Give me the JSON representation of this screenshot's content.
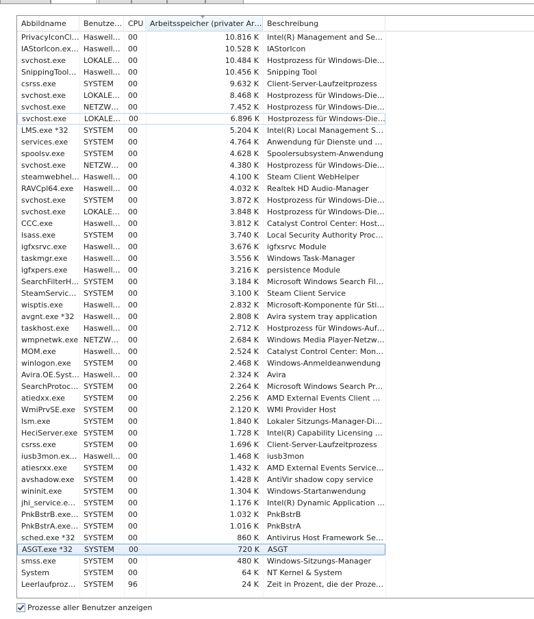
{
  "columns": [
    "Abbildname",
    "Benutze…",
    "CPU",
    "Arbeitsspeicher (privater Arbei…",
    "Beschreibung"
  ],
  "sorted_column": "Arbeitsspeicher (privater Arbei…",
  "selected_process": "ASGT.exe *32",
  "hovered_process": "svchost.exe",
  "processes": [
    {
      "name": "PrivacyIconCli…",
      "user": "Haswell…",
      "cpu": "00",
      "mem": "10.816 K",
      "desc": "Intel(R) Management and Secu…"
    },
    {
      "name": "IAStorIcon.ex…",
      "user": "Haswell…",
      "cpu": "00",
      "mem": "10.528 K",
      "desc": "IAStorIcon"
    },
    {
      "name": "svchost.exe",
      "user": "LOKALE…",
      "cpu": "00",
      "mem": "10.484 K",
      "desc": "Hostprozess für Windows-Dienste"
    },
    {
      "name": "SnippingTool…",
      "user": "Haswell…",
      "cpu": "00",
      "mem": "10.456 K",
      "desc": "Snipping Tool"
    },
    {
      "name": "csrss.exe",
      "user": "SYSTEM",
      "cpu": "00",
      "mem": "9.632 K",
      "desc": "Client-Server-Laufzeitprozess"
    },
    {
      "name": "svchost.exe",
      "user": "LOKALE…",
      "cpu": "00",
      "mem": "8.468 K",
      "desc": "Hostprozess für Windows-Dienste"
    },
    {
      "name": "svchost.exe",
      "user": "NETZW…",
      "cpu": "00",
      "mem": "7.452 K",
      "desc": "Hostprozess für Windows-Dienste"
    },
    {
      "name": "svchost.exe",
      "user": "LOKALE…",
      "cpu": "00",
      "mem": "6.896 K",
      "desc": "Hostprozess für Windows-Dienste"
    },
    {
      "name": "LMS.exe *32",
      "user": "SYSTEM",
      "cpu": "00",
      "mem": "5.204 K",
      "desc": "Intel(R) Local Management Ser…"
    },
    {
      "name": "services.exe",
      "user": "SYSTEM",
      "cpu": "00",
      "mem": "4.764 K",
      "desc": "Anwendung für Dienste und Co…"
    },
    {
      "name": "spoolsv.exe",
      "user": "SYSTEM",
      "cpu": "00",
      "mem": "4.628 K",
      "desc": "Spoolersubsystem-Anwendung"
    },
    {
      "name": "svchost.exe",
      "user": "NETZW…",
      "cpu": "00",
      "mem": "4.380 K",
      "desc": "Hostprozess für Windows-Dienste"
    },
    {
      "name": "steamwebhel…",
      "user": "Haswell…",
      "cpu": "00",
      "mem": "4.100 K",
      "desc": "Steam Client WebHelper"
    },
    {
      "name": "RAVCpl64.exe",
      "user": "Haswell…",
      "cpu": "00",
      "mem": "4.032 K",
      "desc": "Realtek HD Audio-Manager"
    },
    {
      "name": "svchost.exe",
      "user": "SYSTEM",
      "cpu": "00",
      "mem": "3.872 K",
      "desc": "Hostprozess für Windows-Dienste"
    },
    {
      "name": "svchost.exe",
      "user": "LOKALE…",
      "cpu": "00",
      "mem": "3.848 K",
      "desc": "Hostprozess für Windows-Dienste"
    },
    {
      "name": "CCC.exe",
      "user": "Haswell…",
      "cpu": "00",
      "mem": "3.812 K",
      "desc": "Catalyst Control Center: Host a…"
    },
    {
      "name": "lsass.exe",
      "user": "SYSTEM",
      "cpu": "00",
      "mem": "3.740 K",
      "desc": "Local Security Authority Process"
    },
    {
      "name": "igfxsrvc.exe",
      "user": "Haswell…",
      "cpu": "00",
      "mem": "3.676 K",
      "desc": "igfxsrvc Module"
    },
    {
      "name": "taskmgr.exe",
      "user": "Haswell…",
      "cpu": "00",
      "mem": "3.556 K",
      "desc": "Windows Task-Manager"
    },
    {
      "name": "igfxpers.exe",
      "user": "Haswell…",
      "cpu": "00",
      "mem": "3.216 K",
      "desc": "persistence Module"
    },
    {
      "name": "SearchFilterH…",
      "user": "SYSTEM",
      "cpu": "00",
      "mem": "3.184 K",
      "desc": "Microsoft Windows Search Filte…"
    },
    {
      "name": "SteamService…",
      "user": "SYSTEM",
      "cpu": "00",
      "mem": "3.100 K",
      "desc": "Steam Client Service"
    },
    {
      "name": "wisptis.exe",
      "user": "Haswell…",
      "cpu": "00",
      "mem": "2.832 K",
      "desc": "Microsoft-Komponente für Stift-…"
    },
    {
      "name": "avgnt.exe *32",
      "user": "Haswell…",
      "cpu": "00",
      "mem": "2.808 K",
      "desc": "Avira system tray application"
    },
    {
      "name": "taskhost.exe",
      "user": "Haswell…",
      "cpu": "00",
      "mem": "2.712 K",
      "desc": "Hostprozess für Windows-Aufg…"
    },
    {
      "name": "wmpnetwk.exe",
      "user": "NETZW…",
      "cpu": "00",
      "mem": "2.684 K",
      "desc": "Windows Media Player-Netzwer…"
    },
    {
      "name": "MOM.exe",
      "user": "Haswell…",
      "cpu": "00",
      "mem": "2.524 K",
      "desc": "Catalyst Control Center: Monit…"
    },
    {
      "name": "winlogon.exe",
      "user": "SYSTEM",
      "cpu": "00",
      "mem": "2.468 K",
      "desc": "Windows-Anmeldeanwendung"
    },
    {
      "name": "Avira.OE.Syst…",
      "user": "Haswell…",
      "cpu": "00",
      "mem": "2.324 K",
      "desc": "Avira"
    },
    {
      "name": "SearchProtoc…",
      "user": "SYSTEM",
      "cpu": "00",
      "mem": "2.264 K",
      "desc": "Microsoft Windows Search Prot…"
    },
    {
      "name": "atiedxx.exe",
      "user": "SYSTEM",
      "cpu": "00",
      "mem": "2.256 K",
      "desc": "AMD External Events Client Mo…"
    },
    {
      "name": "WmiPrvSE.exe",
      "user": "SYSTEM",
      "cpu": "00",
      "mem": "2.120 K",
      "desc": "WMI Provider Host"
    },
    {
      "name": "lsm.exe",
      "user": "SYSTEM",
      "cpu": "00",
      "mem": "1.840 K",
      "desc": "Lokaler Sitzungs-Manager-Dienst"
    },
    {
      "name": "HeciServer.exe",
      "user": "SYSTEM",
      "cpu": "00",
      "mem": "1.728 K",
      "desc": "Intel(R) Capability Licensing Ser…"
    },
    {
      "name": "csrss.exe",
      "user": "SYSTEM",
      "cpu": "00",
      "mem": "1.696 K",
      "desc": "Client-Server-Laufzeitprozess"
    },
    {
      "name": "iusb3mon.exe…",
      "user": "Haswell…",
      "cpu": "00",
      "mem": "1.468 K",
      "desc": "iusb3mon"
    },
    {
      "name": "atiesrxx.exe",
      "user": "SYSTEM",
      "cpu": "00",
      "mem": "1.432 K",
      "desc": "AMD External Events Service M…"
    },
    {
      "name": "avshadow.exe",
      "user": "SYSTEM",
      "cpu": "00",
      "mem": "1.428 K",
      "desc": "AntiVir shadow copy service"
    },
    {
      "name": "wininit.exe",
      "user": "SYSTEM",
      "cpu": "00",
      "mem": "1.304 K",
      "desc": "Windows-Startanwendung"
    },
    {
      "name": "jhi_service.ex…",
      "user": "SYSTEM",
      "cpu": "00",
      "mem": "1.176 K",
      "desc": "Intel(R) Dynamic Application Lo…"
    },
    {
      "name": "PnkBstrB.exe …",
      "user": "SYSTEM",
      "cpu": "00",
      "mem": "1.032 K",
      "desc": "PnkBstrB"
    },
    {
      "name": "PnkBstrA.exe …",
      "user": "SYSTEM",
      "cpu": "00",
      "mem": "1.016 K",
      "desc": "PnkBstrA"
    },
    {
      "name": "sched.exe *32",
      "user": "SYSTEM",
      "cpu": "00",
      "mem": "860 K",
      "desc": "Antivirus Host Framework Service"
    },
    {
      "name": "ASGT.exe *32",
      "user": "SYSTEM",
      "cpu": "00",
      "mem": "720 K",
      "desc": "ASGT"
    },
    {
      "name": "smss.exe",
      "user": "SYSTEM",
      "cpu": "00",
      "mem": "480 K",
      "desc": "Windows-Sitzungs-Manager"
    },
    {
      "name": "System",
      "user": "SYSTEM",
      "cpu": "00",
      "mem": "64 K",
      "desc": "NT Kernel & System"
    },
    {
      "name": "Leerlaufprozess",
      "user": "SYSTEM",
      "cpu": "96",
      "mem": "24 K",
      "desc": "Zeit in Prozent, die der Prozess…"
    }
  ],
  "footer": {
    "show_all_users_label": "Prozesse aller Benutzer anzeigen",
    "show_all_users_checked": true
  }
}
